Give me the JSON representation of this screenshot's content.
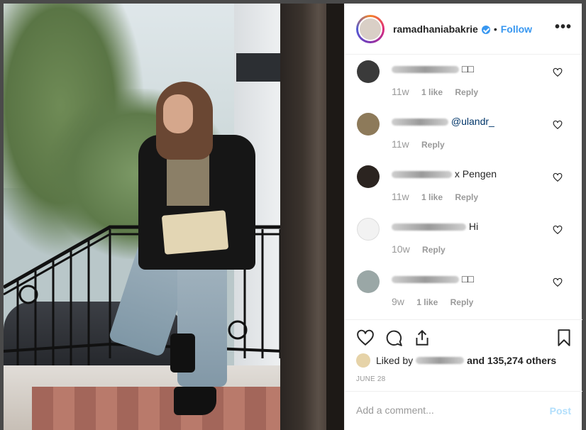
{
  "header": {
    "username": "ramadhaniabakrie",
    "follow_label": "Follow",
    "separator": "•",
    "more_label": "•••"
  },
  "comments": [
    {
      "text_suffix": "□□",
      "time": "11w",
      "likes": "1 like",
      "reply": "Reply"
    },
    {
      "text_suffix": "@ulandr_",
      "time": "11w",
      "likes": "",
      "reply": "Reply"
    },
    {
      "text_suffix": "x Pengen",
      "time": "11w",
      "likes": "1 like",
      "reply": "Reply"
    },
    {
      "text_suffix": "Hi",
      "time": "10w",
      "likes": "",
      "reply": "Reply"
    },
    {
      "text_suffix": "□□",
      "time": "9w",
      "likes": "1 like",
      "reply": "Reply"
    }
  ],
  "likes": {
    "prefix": "Liked by",
    "suffix": "and 135,274 others"
  },
  "date": "JUNE 28",
  "add_comment": {
    "placeholder": "Add a comment...",
    "post_label": "Post"
  },
  "colors": {
    "accent": "#3897f0",
    "post_disabled": "#b2dffc"
  }
}
